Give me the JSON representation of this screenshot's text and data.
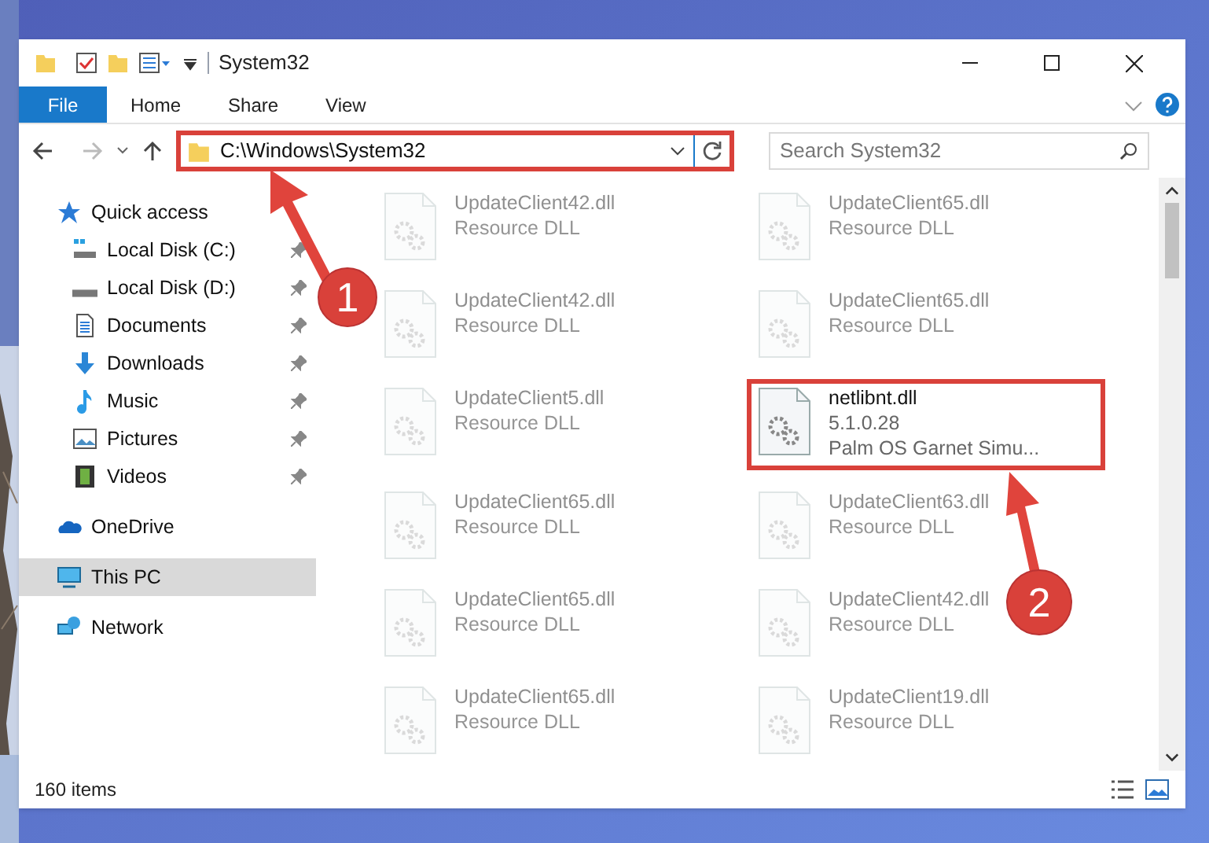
{
  "window": {
    "title": "System32"
  },
  "ribbon": {
    "tabs": [
      {
        "label": "File",
        "selected": true
      },
      {
        "label": "Home",
        "selected": false
      },
      {
        "label": "Share",
        "selected": false
      },
      {
        "label": "View",
        "selected": false
      }
    ]
  },
  "address_bar": {
    "path": "C:\\Windows\\System32",
    "highlighted": true
  },
  "search": {
    "placeholder": "Search System32"
  },
  "sidebar": {
    "items": [
      {
        "label": "Quick access",
        "pinned": false,
        "selected": false,
        "indented": false
      },
      {
        "label": "Local Disk (C:)",
        "pinned": true,
        "selected": false,
        "indented": true
      },
      {
        "label": "Local Disk (D:)",
        "pinned": true,
        "selected": false,
        "indented": true
      },
      {
        "label": "Documents",
        "pinned": true,
        "selected": false,
        "indented": true
      },
      {
        "label": "Downloads",
        "pinned": true,
        "selected": false,
        "indented": true
      },
      {
        "label": "Music",
        "pinned": true,
        "selected": false,
        "indented": true
      },
      {
        "label": "Pictures",
        "pinned": true,
        "selected": false,
        "indented": true
      },
      {
        "label": "Videos",
        "pinned": true,
        "selected": false,
        "indented": true
      },
      {
        "label": "OneDrive",
        "pinned": false,
        "selected": false,
        "indented": false
      },
      {
        "label": "This PC",
        "pinned": false,
        "selected": true,
        "indented": false
      },
      {
        "label": "Network",
        "pinned": false,
        "selected": false,
        "indented": false
      }
    ]
  },
  "files": [
    {
      "name": "UpdateClient42.dll",
      "details": [
        "Resource DLL"
      ],
      "highlighted": false
    },
    {
      "name": "UpdateClient65.dll",
      "details": [
        "Resource DLL"
      ],
      "highlighted": false
    },
    {
      "name": "UpdateClient42.dll",
      "details": [
        "Resource DLL"
      ],
      "highlighted": false
    },
    {
      "name": "UpdateClient65.dll",
      "details": [
        "Resource DLL"
      ],
      "highlighted": false
    },
    {
      "name": "UpdateClient5.dll",
      "details": [
        "Resource DLL"
      ],
      "highlighted": false
    },
    {
      "name": "netlibnt.dll",
      "details": [
        "5.1.0.28",
        "Palm OS Garnet Simu..."
      ],
      "highlighted": true
    },
    {
      "name": "UpdateClient65.dll",
      "details": [
        "Resource DLL"
      ],
      "highlighted": false
    },
    {
      "name": "UpdateClient63.dll",
      "details": [
        "Resource DLL"
      ],
      "highlighted": false
    },
    {
      "name": "UpdateClient65.dll",
      "details": [
        "Resource DLL"
      ],
      "highlighted": false
    },
    {
      "name": "UpdateClient42.dll",
      "details": [
        "Resource DLL"
      ],
      "highlighted": false
    },
    {
      "name": "UpdateClient65.dll",
      "details": [
        "Resource DLL"
      ],
      "highlighted": false
    },
    {
      "name": "UpdateClient19.dll",
      "details": [
        "Resource DLL"
      ],
      "highlighted": false
    }
  ],
  "status_bar": {
    "item_count": "160 items"
  },
  "annotations": [
    {
      "label": "1"
    },
    {
      "label": "2"
    }
  ]
}
